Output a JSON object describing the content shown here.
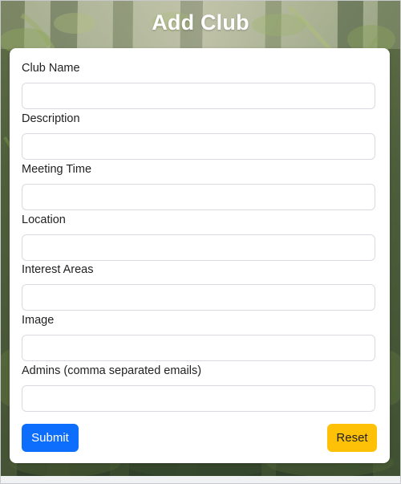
{
  "page": {
    "title": "Add Club"
  },
  "form": {
    "fields": [
      {
        "label": "Club Name",
        "value": ""
      },
      {
        "label": "Description",
        "value": ""
      },
      {
        "label": "Meeting Time",
        "value": ""
      },
      {
        "label": "Location",
        "value": ""
      },
      {
        "label": "Interest Areas",
        "value": ""
      },
      {
        "label": "Image",
        "value": ""
      },
      {
        "label": "Admins (comma separated emails)",
        "value": ""
      }
    ],
    "submit_label": "Submit",
    "reset_label": "Reset"
  },
  "colors": {
    "submit_button": "#0d6efd",
    "reset_button": "#ffc107",
    "card_background": "#ffffff",
    "title_text": "#ffffff"
  }
}
